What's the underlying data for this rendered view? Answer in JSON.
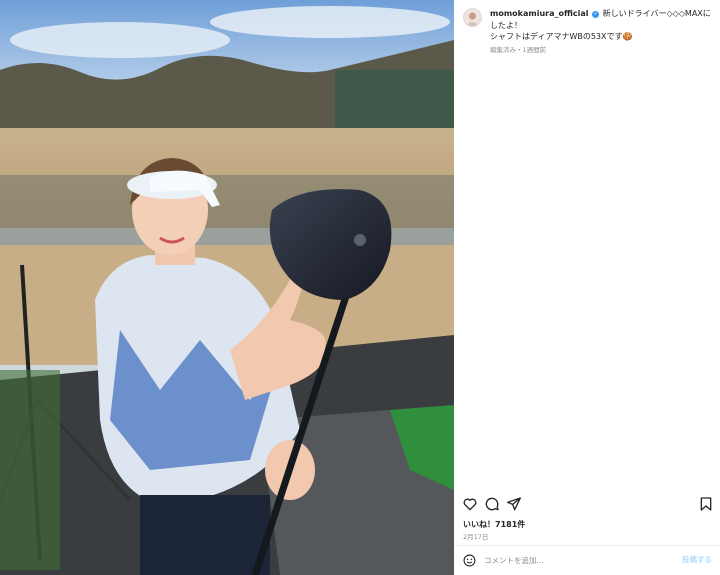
{
  "post": {
    "username": "momokamiura_official",
    "caption_line1": "新しいドライバー◇◇◇MAXにしたよ！",
    "caption_line2": "シャフトはディアマナWBの53Xです🍪",
    "meta": "編集済み・1週間前",
    "likes": "いいね！7181件",
    "date": "2月17日"
  },
  "comment": {
    "placeholder": "コメントを追加...",
    "post_label": "投稿する"
  },
  "icons": {
    "like": "heart-icon",
    "comment": "comment-icon",
    "share": "share-icon",
    "save": "bookmark-icon",
    "emoji": "smiley-icon",
    "verified": "verified-badge-icon"
  },
  "colors": {
    "verified": "#3897f0",
    "post_button": "#b2dffc",
    "meta": "#8e8e8e"
  }
}
